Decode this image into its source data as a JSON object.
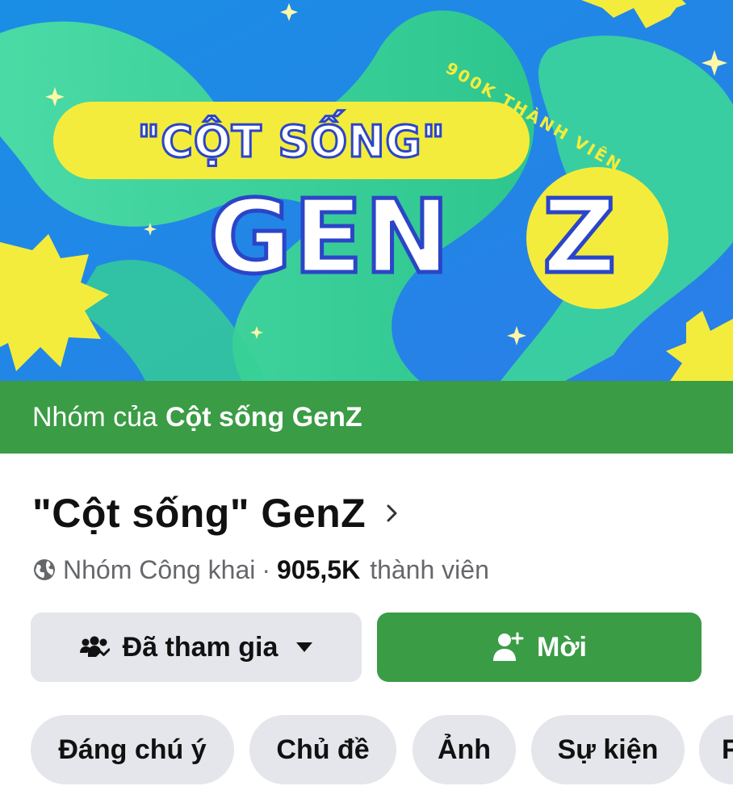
{
  "cover": {
    "pill_text": "\"CỘT SỐNG\"",
    "big_text": "GEN",
    "big_letter": "Z",
    "arc_text": "900K THÀNH VIÊN"
  },
  "banner": {
    "prefix": "Nhóm của",
    "group_name": "Cột sống GenZ"
  },
  "group": {
    "title": "\"Cột sống\" GenZ",
    "privacy": "Nhóm Công khai",
    "separator": "·",
    "member_count": "905,5K",
    "member_label": "thành viên"
  },
  "actions": {
    "joined_label": "Đã tham gia",
    "invite_label": "Mời"
  },
  "tabs": [
    {
      "label": "Đáng chú ý"
    },
    {
      "label": "Chủ đề"
    },
    {
      "label": "Ảnh"
    },
    {
      "label": "Sự kiện"
    },
    {
      "label": "F"
    }
  ],
  "icons": {
    "globe": "globe-icon",
    "chevron": "chevron-right-icon",
    "members": "people-check-icon",
    "caret": "caret-down-icon",
    "add_person": "add-person-icon"
  },
  "colors": {
    "brand_green": "#3a9c45",
    "button_gray": "#e4e6eb",
    "cover_blue": "#1d8fe0",
    "cover_yellow": "#f4ec3c",
    "cover_green": "#35d39a"
  }
}
